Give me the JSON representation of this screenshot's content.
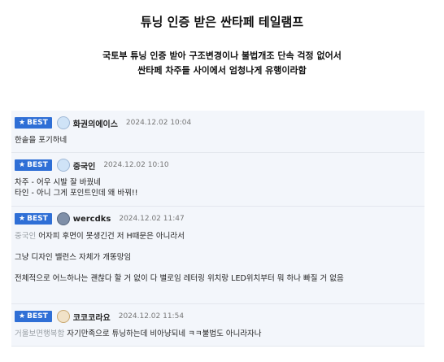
{
  "article": {
    "title": "튜닝 인증 받은 싼타페 테일램프",
    "subtitle_line1": "국토부 튜닝 인증 받아 구조변경이나 불법개조 단속 걱정 없어서",
    "subtitle_line2": "싼타페 차주들 사이에서 엄청나게 유행이라함"
  },
  "badge_label": "BEST",
  "comments": [
    {
      "nick": "화권의에이스",
      "time": "2024.12.02 10:04",
      "lines": [
        "한솥을 포기하네"
      ]
    },
    {
      "nick": "중국인",
      "time": "2024.12.02 10:10",
      "lines": [
        "차주 - 어우 시발 잘 바꿨네",
        "타인 - 아니 그게 포인트인데 왜 바꿔!!"
      ]
    },
    {
      "nick": "wercdks",
      "time": "2024.12.02 11:47",
      "mention": "중국인",
      "lines": [
        "어자피 후면이 못생긴건 저 H때문은 아니라서",
        "그냥 디자인 밸런스 자체가 개똥망임",
        "전체적으로 어느하나는 괜찮다 할 거 없이 다 별로임 레터링 위치랑 LED위치부터 뭐 하나 빠질 거 없음"
      ]
    },
    {
      "nick": "코코코라요",
      "time": "2024.12.02 11:54",
      "mention": "거울보면행복함",
      "lines": [
        "자기만족으로 튜닝하는데 비아냥되네 ㅋㅋ불법도 아니라자나"
      ]
    }
  ]
}
